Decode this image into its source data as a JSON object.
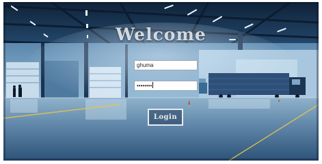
{
  "page": {
    "title": "Welcome",
    "background_scene": "warehouse-interior"
  },
  "form": {
    "username_value": "ghuma",
    "password_value": "••••••••",
    "login_label": "Login"
  },
  "colors": {
    "title_text": "#d4d9de",
    "field_background": "#ffffff",
    "button_border": "#e7ebef",
    "background_dark": "#1d3f66"
  }
}
